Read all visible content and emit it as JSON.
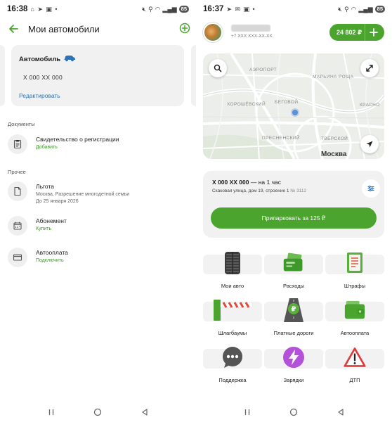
{
  "left_screen": {
    "status_bar": {
      "time": "16:38",
      "battery": "85"
    },
    "header": {
      "title": "Мои автомобили"
    },
    "car_card": {
      "label": "Автомобиль",
      "plate": "Х 000 ХХ 000",
      "edit_label": "Редактировать"
    },
    "documents": {
      "section_label": "Документы",
      "items": [
        {
          "title": "Свидетельство о регистрации",
          "action": "Добавить",
          "icon": "document-list-icon"
        }
      ]
    },
    "other": {
      "section_label": "Прочее",
      "items": [
        {
          "title": "Льгота",
          "detail_line1": "Москва, Разрешение многодетной семьи",
          "detail_line2": "До 25 января 2026",
          "icon": "file-icon"
        },
        {
          "title": "Абонемент",
          "action": "Купить",
          "icon": "calendar-icon"
        },
        {
          "title": "Автооплата",
          "action": "Подключить",
          "icon": "card-icon"
        }
      ]
    }
  },
  "right_screen": {
    "status_bar": {
      "time": "16:37",
      "battery": "85"
    },
    "profile": {
      "phone": "+7 ХХХ ХХХ-ХХ-ХХ"
    },
    "balance": {
      "amount": "24 802 ₽"
    },
    "map": {
      "labels": [
        "АЭРОПОРТ",
        "МАРЬИНА РОЩА",
        "ХОРОШЁВСКИЙ",
        "БЕГОВОЙ",
        "КРАСНО",
        "ПРЕСНЕНСКИЙ",
        "ТВЕРСКОЙ"
      ],
      "city": "Москва"
    },
    "parking": {
      "plate": "Х 000 ХХ 000",
      "duration": " — на 1 час",
      "address": "Скаковая улица, дом 19, строение 1",
      "zone": "№ 3112",
      "button_label": "Припарковать за 125 ₽"
    },
    "services": [
      {
        "label": "Мои авто",
        "icon": "tire-icon"
      },
      {
        "label": "Расходы",
        "icon": "wallet-cash-icon"
      },
      {
        "label": "Штрафы",
        "icon": "fine-receipt-icon"
      },
      {
        "label": "Шлагбаумы",
        "icon": "barrier-icon"
      },
      {
        "label": "Платные дороги",
        "icon": "toll-road-icon"
      },
      {
        "label": "Автооплата",
        "icon": "autopay-wallet-icon"
      },
      {
        "label": "Поддержка",
        "icon": "chat-icon"
      },
      {
        "label": "Зарядки",
        "icon": "charging-icon"
      },
      {
        "label": "ДТП",
        "icon": "warning-icon"
      }
    ]
  },
  "colors": {
    "accent_green": "#4aa42e",
    "link_blue": "#2d72b9",
    "card_gray": "#f1f1f1"
  }
}
